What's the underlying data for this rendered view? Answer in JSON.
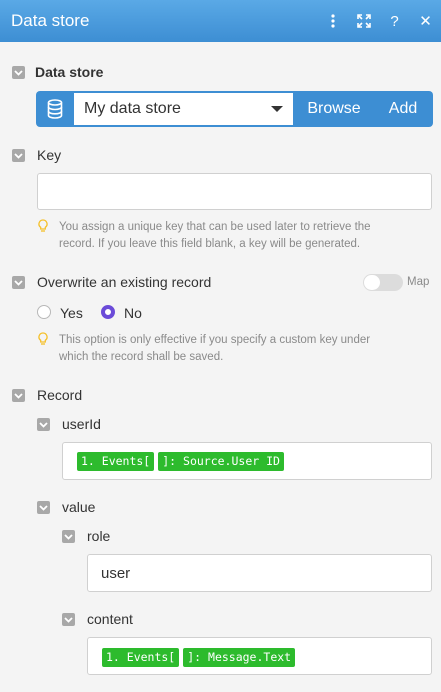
{
  "header": {
    "title": "Data store",
    "icons": [
      "more-vertical-icon",
      "expand-icon",
      "help-icon",
      "close-icon"
    ],
    "help_label": "?",
    "close_label": "✕"
  },
  "data_store": {
    "label": "Data store",
    "selected": "My data store",
    "browse_label": "Browse",
    "add_label": "Add"
  },
  "key": {
    "label": "Key",
    "value": "",
    "hint_line1": "You assign a unique key that can be used later to retrieve the",
    "hint_line2": "record. If you leave this field blank, a key will be generated."
  },
  "overwrite": {
    "label": "Overwrite an existing record",
    "map_label": "Map",
    "map_enabled": false,
    "yes_label": "Yes",
    "no_label": "No",
    "selected": "No",
    "hint_line1": "This option is only effective if you specify a custom key under",
    "hint_line2": "which the record shall be saved."
  },
  "record": {
    "label": "Record",
    "userId": {
      "label": "userId",
      "token_a": "1. Events[",
      "token_b": "]: Source.User ID"
    },
    "value": {
      "label": "value",
      "role": {
        "label": "role",
        "value": "user"
      },
      "content": {
        "label": "content",
        "token_a": "1. Events[",
        "token_b": "]: Message.Text"
      }
    }
  },
  "colors": {
    "header": "#3d8ed3",
    "accent_blue": "#3d8ed3",
    "radio_selected": "#6b4bd8",
    "token_green": "#2dbb2d",
    "hint_icon": "#f5c02a"
  }
}
